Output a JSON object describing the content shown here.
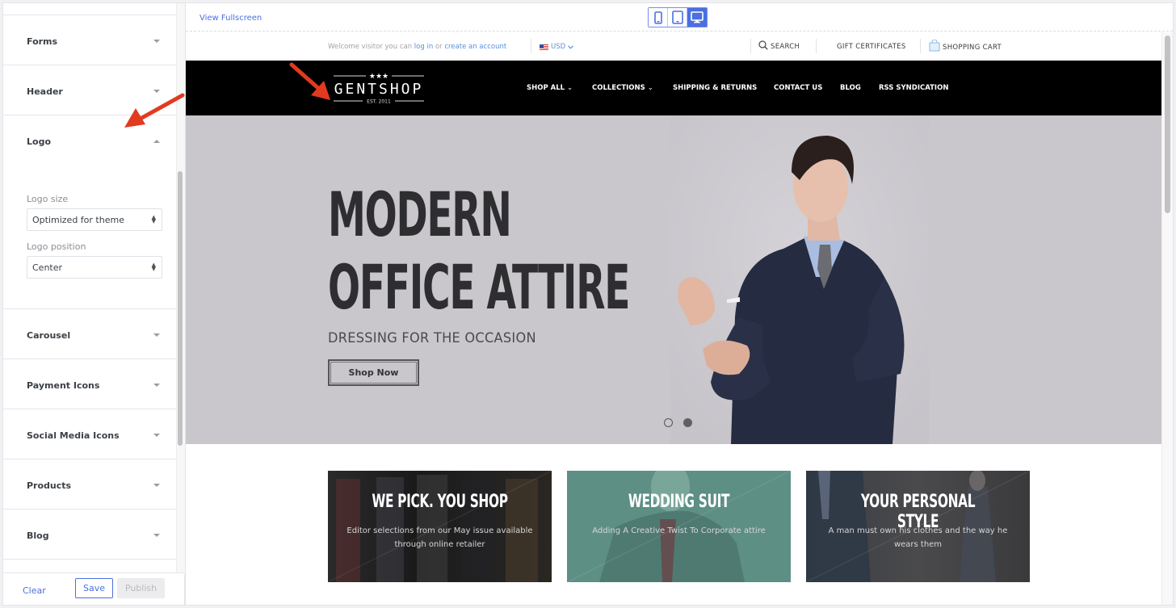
{
  "panel": {
    "sections": [
      {
        "title": "Forms",
        "expanded": false
      },
      {
        "title": "Header",
        "expanded": false
      },
      {
        "title": "Logo",
        "expanded": true
      },
      {
        "title": "Carousel",
        "expanded": false
      },
      {
        "title": "Payment Icons",
        "expanded": false
      },
      {
        "title": "Social Media Icons",
        "expanded": false
      },
      {
        "title": "Products",
        "expanded": false
      },
      {
        "title": "Blog",
        "expanded": false
      }
    ],
    "logo": {
      "size_label": "Logo size",
      "size_value": "Optimized for theme",
      "position_label": "Logo position",
      "position_value": "Center"
    },
    "footer": {
      "clear": "Clear",
      "save": "Save",
      "publish": "Publish"
    }
  },
  "preview": {
    "view_fullscreen": "View Fullscreen",
    "devices": [
      {
        "name": "mobile",
        "active": false
      },
      {
        "name": "tablet",
        "active": false
      },
      {
        "name": "desktop",
        "active": true
      }
    ],
    "accent_color": "#4a6fe0"
  },
  "site": {
    "topbar": {
      "welcome_prefix": "Welcome visitor you can",
      "login": "log in",
      "or": "or",
      "create_account": "create an account",
      "currency": "USD",
      "search": "SEARCH",
      "gift_certificates": "GIFT CERTIFICATES",
      "shopping_cart": "SHOPPING CART"
    },
    "logo": {
      "name": "GENTSHOP",
      "est": "EST. 2011"
    },
    "nav": [
      {
        "label": "SHOP ALL",
        "dropdown": true
      },
      {
        "label": "COLLECTIONS",
        "dropdown": true
      },
      {
        "label": "SHIPPING & RETURNS",
        "dropdown": false
      },
      {
        "label": "CONTACT US",
        "dropdown": false
      },
      {
        "label": "BLOG",
        "dropdown": false
      },
      {
        "label": "RSS SYNDICATION",
        "dropdown": false
      }
    ],
    "hero": {
      "title_line1": "MODERN",
      "title_line2": "OFFICE ATTIRE",
      "subtitle": "DRESSING FOR THE OCCASION",
      "button": "Shop Now",
      "slide_count": 2,
      "active_slide": 2
    },
    "tiles": [
      {
        "title": "WE PICK. YOU SHOP",
        "desc": "Editor selections from our May issue available through online retailer"
      },
      {
        "title": "WEDDING SUIT",
        "desc": "Adding A Creative Twist To Corporate attire"
      },
      {
        "title": "YOUR PERSONAL STYLE",
        "desc": "A man must own his clothes and the way he wears them"
      }
    ]
  }
}
